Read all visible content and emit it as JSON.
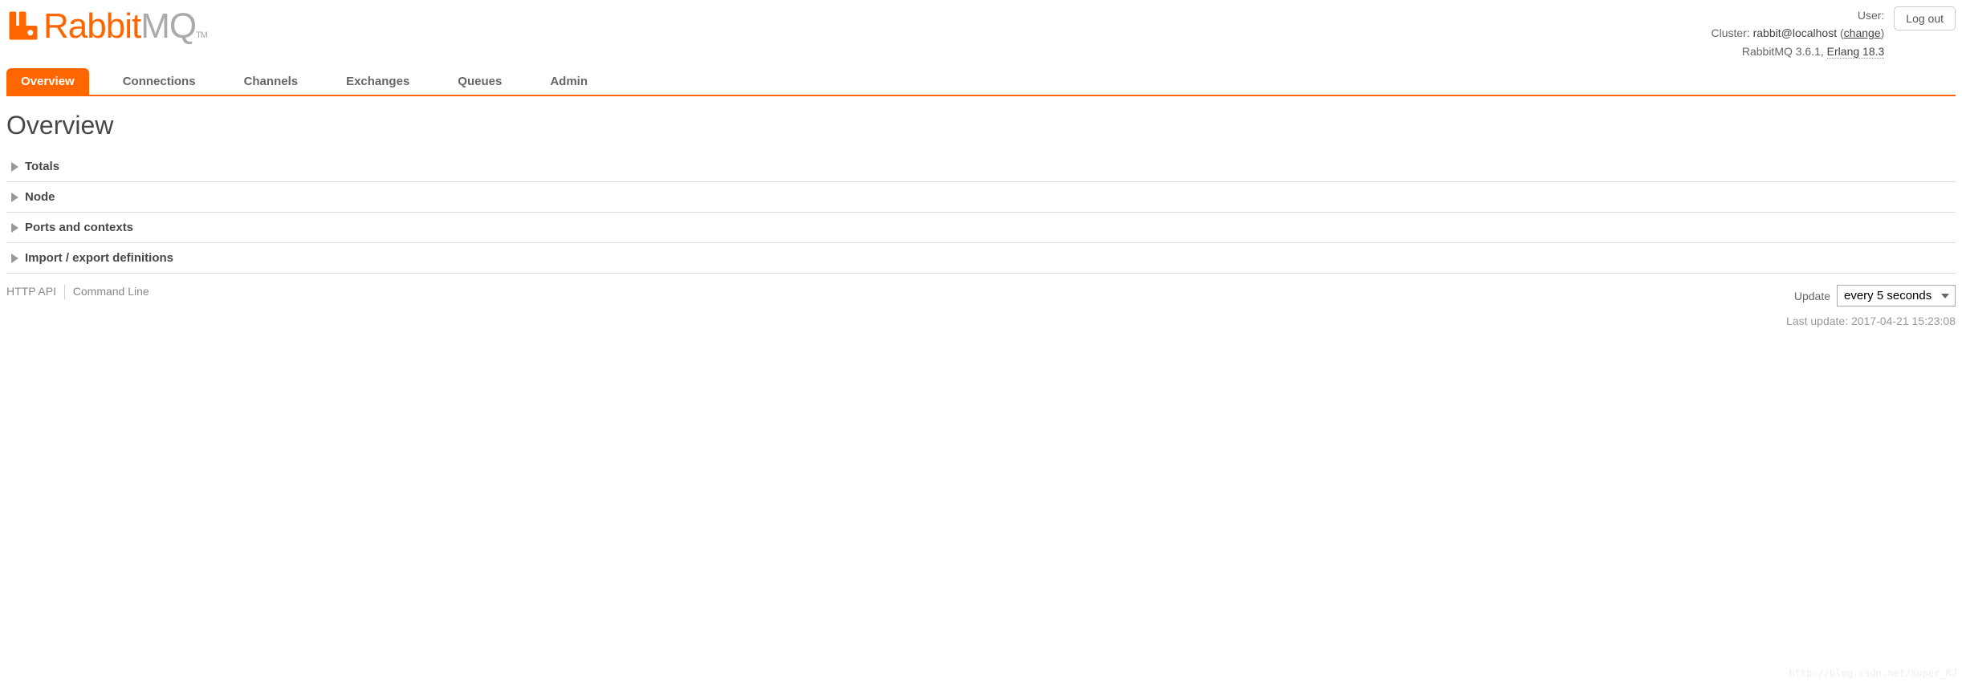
{
  "header": {
    "logo_rabbit": "Rabbit",
    "logo_mq": "MQ",
    "logo_tm": "TM",
    "user_label": "User:",
    "cluster_label": "Cluster:",
    "cluster_value": "rabbit@localhost",
    "change_link": "change",
    "version_label": "RabbitMQ 3.6.1,",
    "erlang_label": "Erlang 18.3",
    "logout": "Log out"
  },
  "tabs": [
    {
      "label": "Overview",
      "active": true
    },
    {
      "label": "Connections"
    },
    {
      "label": "Channels"
    },
    {
      "label": "Exchanges"
    },
    {
      "label": "Queues"
    },
    {
      "label": "Admin"
    }
  ],
  "page_title": "Overview",
  "sections": [
    {
      "label": "Totals"
    },
    {
      "label": "Node"
    },
    {
      "label": "Ports and contexts"
    },
    {
      "label": "Import / export definitions"
    }
  ],
  "footer": {
    "http_api": "HTTP API",
    "cli": "Command Line",
    "update_label": "Update",
    "update_selected": "every 5 seconds",
    "last_update_label": "Last update:",
    "last_update_value": "2017-04-21 15:23:08"
  },
  "watermark": "http://blog.csdn.net/Super_RJ"
}
